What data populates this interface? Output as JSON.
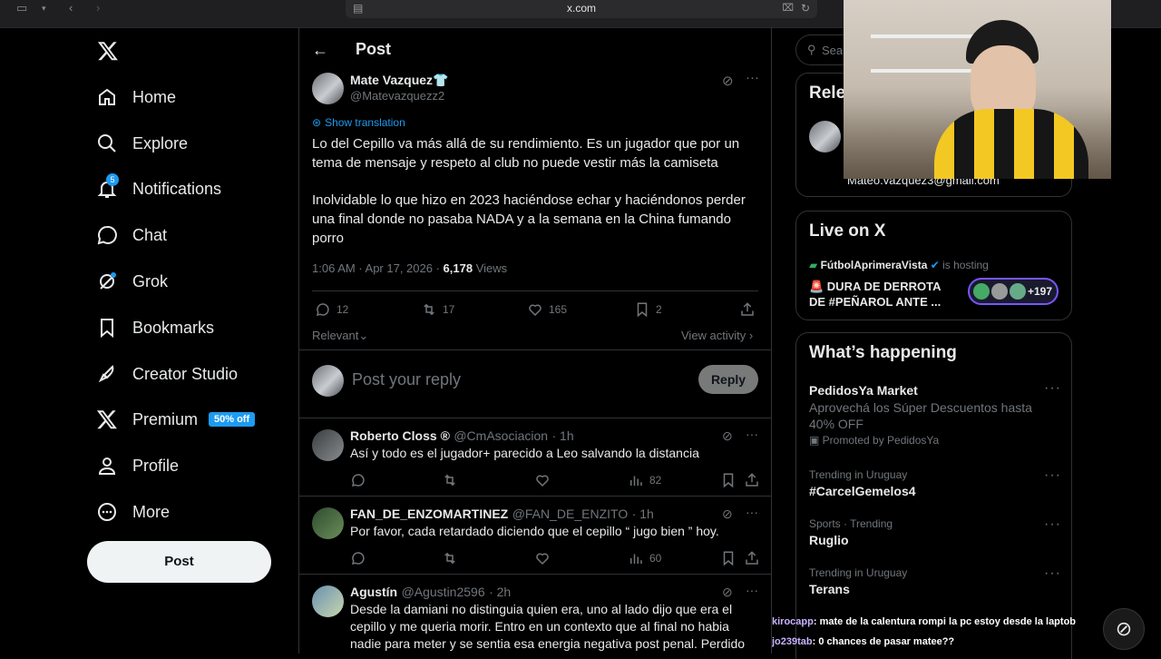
{
  "browser": {
    "url": "x.com"
  },
  "nav": {
    "items": [
      {
        "label": "Home",
        "icon": "home-icon"
      },
      {
        "label": "Explore",
        "icon": "search-icon"
      },
      {
        "label": "Notifications",
        "icon": "bell-icon",
        "badge": "5"
      },
      {
        "label": "Chat",
        "icon": "chat-icon"
      },
      {
        "label": "Grok",
        "icon": "grok-icon"
      },
      {
        "label": "Bookmarks",
        "icon": "bookmark-icon"
      },
      {
        "label": "Creator Studio",
        "icon": "rocket-icon"
      },
      {
        "label": "Premium",
        "icon": "x-logo-icon",
        "badge": "50% off"
      },
      {
        "label": "Profile",
        "icon": "person-icon"
      },
      {
        "label": "More",
        "icon": "more-circle-icon"
      }
    ],
    "post_button": "Post"
  },
  "header": {
    "title": "Post"
  },
  "tweet": {
    "author_name": "Mate Vazquez",
    "author_emoji": "👕",
    "handle": "@Matevazquezz2",
    "translate": "Show translation",
    "text1": "Lo del Cepillo va más allá de su rendimiento. Es un jugador que por un tema de mensaje y respeto al club no puede vestir más la camiseta",
    "text2": "Inolvidable lo que hizo en 2023 haciéndose echar y haciéndonos perder una final donde no pasaba NADA y a la semana en la China fumando porro",
    "time": "1:06 AM · Apr 17, 2026 · ",
    "views_count": "6,178",
    "views_label": " Views",
    "replies": "12",
    "reposts": "17",
    "likes": "165",
    "bookmarks": "2"
  },
  "sort": {
    "label": "Relevant",
    "view_activity": "View activity"
  },
  "composer": {
    "placeholder": "Post your reply",
    "button": "Reply"
  },
  "replies": [
    {
      "name": "Roberto Closs ®",
      "handle": "@CmAsociacion",
      "time": "· 1h",
      "text": "Así y todo es  el jugador+ parecido a Leo salvando la distancia",
      "views": "82"
    },
    {
      "name": "FAN_DE_ENZOMARTINEZ",
      "handle": "@FAN_DE_ENZITO",
      "time": "· 1h",
      "text": "Por favor, cada retardado diciendo que el cepillo “ jugo bien ” hoy.",
      "views": "60"
    },
    {
      "name": "Agustín",
      "handle": "@Agustin2596",
      "time": "· 2h",
      "text": "Desde la damiani no distinguia quien era, uno al lado dijo que era el cepillo y me queria morir. Entro en un contexto que al final no habia nadie para meter y se sentia esa energia negativa post penal. Perdido por perdido, esa"
    }
  ],
  "right": {
    "search_placeholder": "Sear",
    "relevant_title": "Rele",
    "email_fragment": "Mateo.vazquez3@gmail.com",
    "live": {
      "title": "Live on X",
      "host": "FútbolAprimeraVista",
      "hosting": " is hosting",
      "event": "🚨 DURA DE DERROTA DE #PEÑAROL ANTE ...",
      "count": "+197"
    },
    "happening": {
      "title": "What’s happening",
      "promo_name": "PedidosYa Market",
      "promo_text": "Aprovechá los Súper Descuentos hasta 40% OFF",
      "promo_by": "Promoted by PedidosYa",
      "trends": [
        {
          "meta": "Trending in Uruguay",
          "name": "#CarcelGemelos4"
        },
        {
          "meta": "Sports · Trending",
          "name": "Ruglio"
        },
        {
          "meta": "Trending in Uruguay",
          "name": "Terans"
        }
      ]
    }
  },
  "chat_overlay": [
    {
      "user": "kirocapp",
      "msg": ": mate de la calentura rompi la pc estoy desde la laptob"
    },
    {
      "user": "jo239tab",
      "msg": ": 0 chances de pasar matee??"
    }
  ]
}
